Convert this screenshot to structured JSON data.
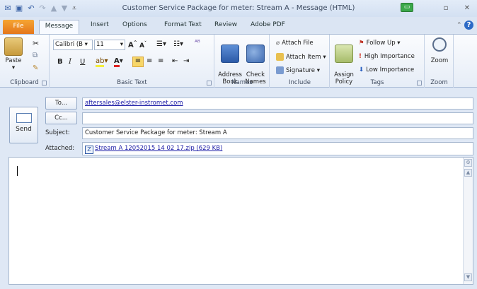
{
  "window": {
    "title": "Customer Service Package for meter: Stream A - Message (HTML)",
    "qat_icons": [
      "outlook-icon",
      "save-icon",
      "undo-icon",
      "redo-icon",
      "up-icon",
      "customize-qat-icon"
    ]
  },
  "tabs": [
    "File",
    "Message",
    "Insert",
    "Options",
    "Format Text",
    "Review",
    "Adobe PDF"
  ],
  "ribbon": {
    "clipboard": {
      "label": "Clipboard",
      "paste": "Paste"
    },
    "basic_text": {
      "label": "Basic Text",
      "font": "Calibri (B",
      "size": "11",
      "bold": "B",
      "italic": "I",
      "underline": "U"
    },
    "names": {
      "label": "Names",
      "address_book": "Address\nBook",
      "check_names": "Check\nNames"
    },
    "include": {
      "label": "Include",
      "attach_file": "Attach File",
      "attach_item": "Attach Item",
      "signature": "Signature"
    },
    "tags": {
      "label": "Tags",
      "assign_policy": "Assign\nPolicy",
      "follow_up": "Follow Up",
      "high_importance": "High Importance",
      "low_importance": "Low Importance"
    },
    "zoom": {
      "label": "Zoom",
      "zoom": "Zoom"
    }
  },
  "header": {
    "send": "Send",
    "to_button": "To...",
    "cc_button": "Cc...",
    "to_value": "aftersales@elster-instromet.com",
    "cc_value": "",
    "subject_label": "Subject:",
    "subject_value": "Customer Service Package for meter: Stream A",
    "attached_label": "Attached:",
    "attachment": "Stream A 12052015 14 02 17.zip (629 KB)"
  },
  "body": {
    "text": ""
  },
  "colors": {
    "file_tab": "#e4761b",
    "accent_blue": "#2c6ac6",
    "follow_up_flag": "#c0392b",
    "high_importance": "#d03020",
    "low_importance": "#2a60c0"
  }
}
